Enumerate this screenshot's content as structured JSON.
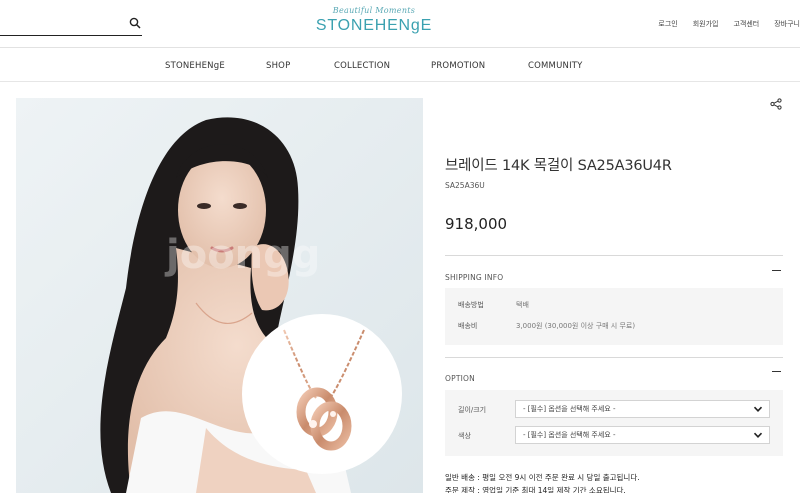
{
  "header": {
    "logo_tagline": "Beautiful Moments",
    "logo_text": "STONEHENgE",
    "util_links": [
      "로그인",
      "회원가입",
      "고객센터",
      "장바구니"
    ]
  },
  "gnb": [
    "STONEHENgE",
    "SHOP",
    "COLLECTION",
    "PROMOTION",
    "COMMUNITY"
  ],
  "product": {
    "name": "브레이드 14K 목걸이 SA25A36U4R",
    "code": "SA25A36U",
    "price": "918,000"
  },
  "shipping": {
    "title": "SHIPPING INFO",
    "rows": [
      {
        "key": "배송방법",
        "value": "택배"
      },
      {
        "key": "배송비",
        "value": "3,000원 (30,000원 이상 구매 시 무료)"
      }
    ]
  },
  "option": {
    "title": "OPTION",
    "rows": [
      {
        "label": "길이/크기",
        "selected": "- [필수] 옵션을 선택해 주세요 -"
      },
      {
        "label": "색상",
        "selected": "- [필수] 옵션을 선택해 주세요 -"
      }
    ]
  },
  "notices": [
    "일반 배송 : 평일 오전 9시 이전 주문 완료 시 당일 출고됩니다.",
    "주문 제작 : 영업일 기준 최대 14일 제작 기간 소요됩니다."
  ],
  "colors": {
    "brand": "#3ba1b0",
    "image_bg": "#e6edf0",
    "rose_gold": "#d9a48c"
  }
}
